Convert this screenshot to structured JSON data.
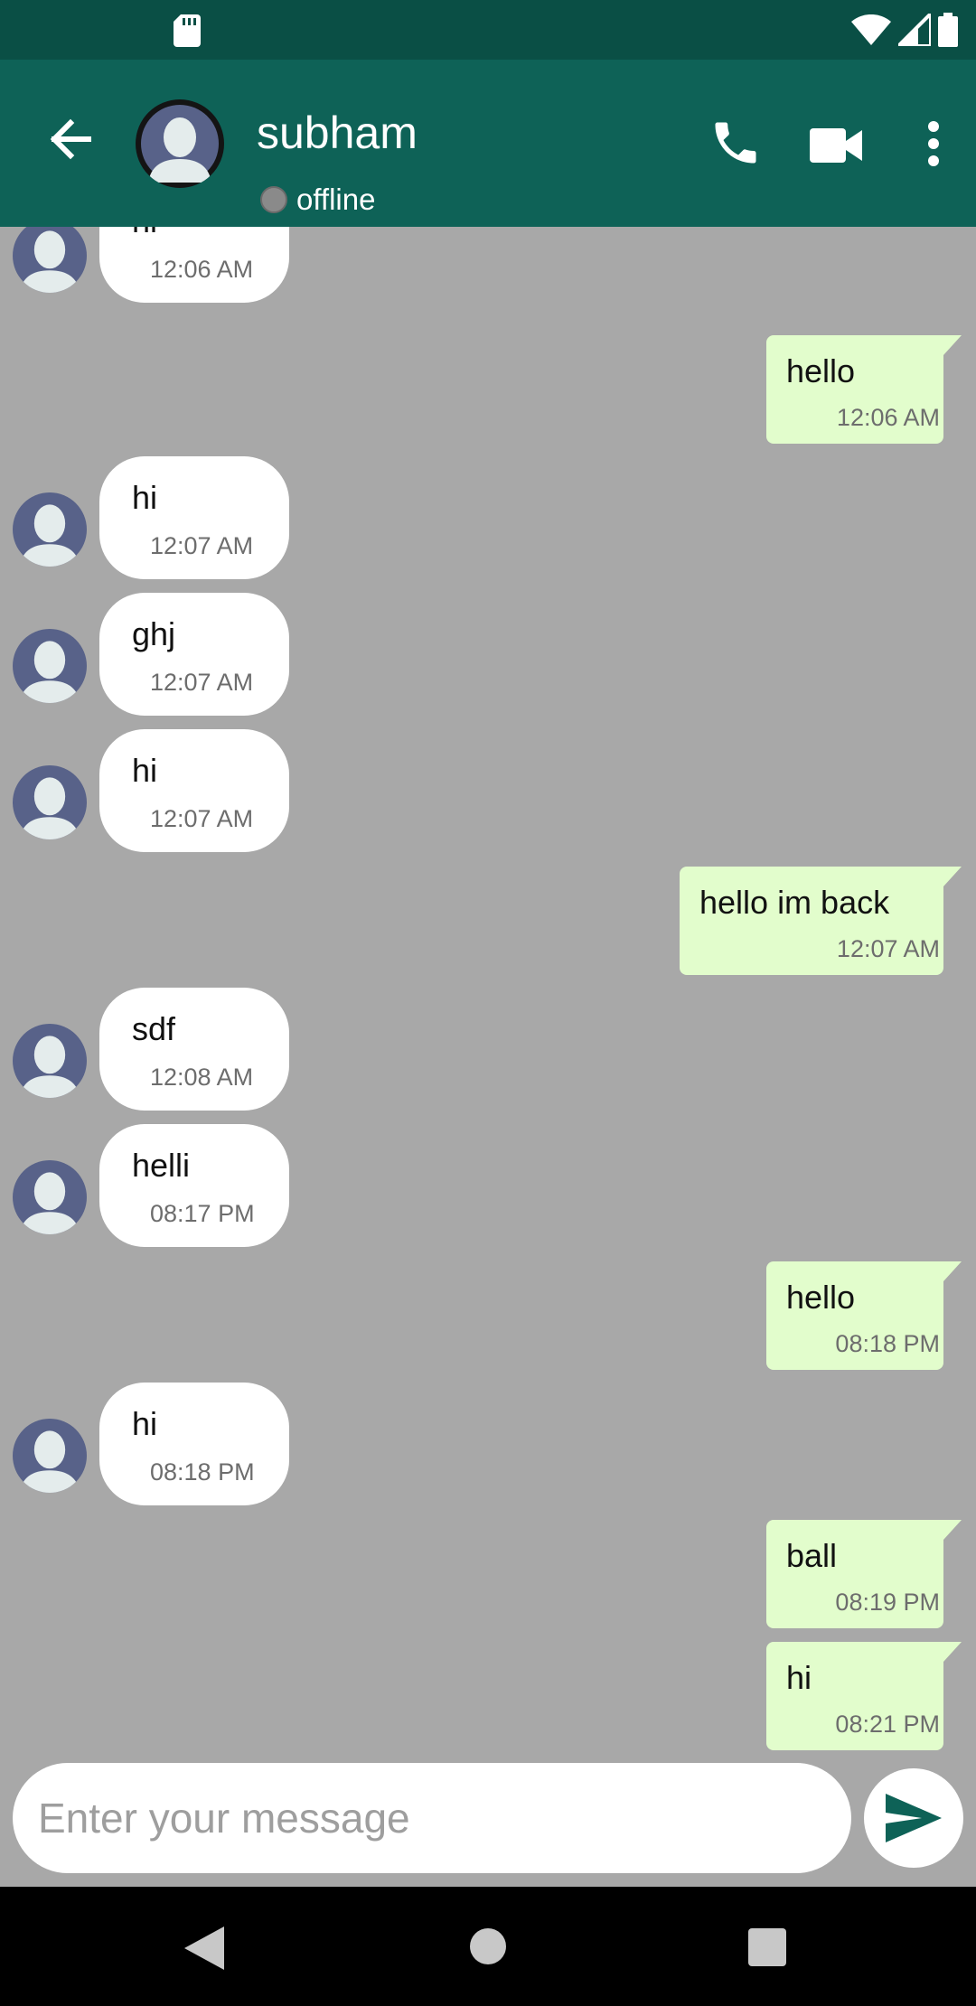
{
  "header": {
    "name": "subham",
    "status": "offline"
  },
  "messages": [
    {
      "dir": "in",
      "text": "hi",
      "time": "12:06 AM"
    },
    {
      "dir": "out",
      "text": "hello",
      "time": "12:06 AM"
    },
    {
      "dir": "in",
      "text": "hi",
      "time": "12:07 AM"
    },
    {
      "dir": "in",
      "text": "ghj",
      "time": "12:07 AM"
    },
    {
      "dir": "in",
      "text": "hi",
      "time": "12:07 AM"
    },
    {
      "dir": "out",
      "text": "hello im back",
      "time": "12:07 AM"
    },
    {
      "dir": "in",
      "text": "sdf",
      "time": "12:08 AM"
    },
    {
      "dir": "in",
      "text": "helli",
      "time": "08:17 PM"
    },
    {
      "dir": "out",
      "text": "hello",
      "time": "08:18 PM"
    },
    {
      "dir": "in",
      "text": "hi",
      "time": "08:18 PM"
    },
    {
      "dir": "out",
      "text": "ball",
      "time": "08:19 PM"
    },
    {
      "dir": "out",
      "text": "hi",
      "time": "08:21 PM"
    }
  ],
  "composer": {
    "placeholder": "Enter your message",
    "value": ""
  },
  "icons": {
    "status_bar": [
      "sd-card-icon",
      "wifi-icon",
      "signal-icon",
      "battery-icon"
    ],
    "app_bar": [
      "back-arrow-icon",
      "phone-icon",
      "video-camera-icon",
      "more-vert-icon"
    ],
    "composer": [
      "send-icon"
    ],
    "nav_bar": [
      "nav-back-icon",
      "nav-home-icon",
      "nav-recents-icon"
    ]
  },
  "colors": {
    "status_bar": "#0a4f45",
    "app_bar": "#0e6257",
    "chat_background": "#a8a8a8",
    "incoming_bubble": "#ffffff",
    "outgoing_bubble": "#e2fdcc",
    "avatar": "#586289",
    "send_icon": "#0e6257"
  }
}
